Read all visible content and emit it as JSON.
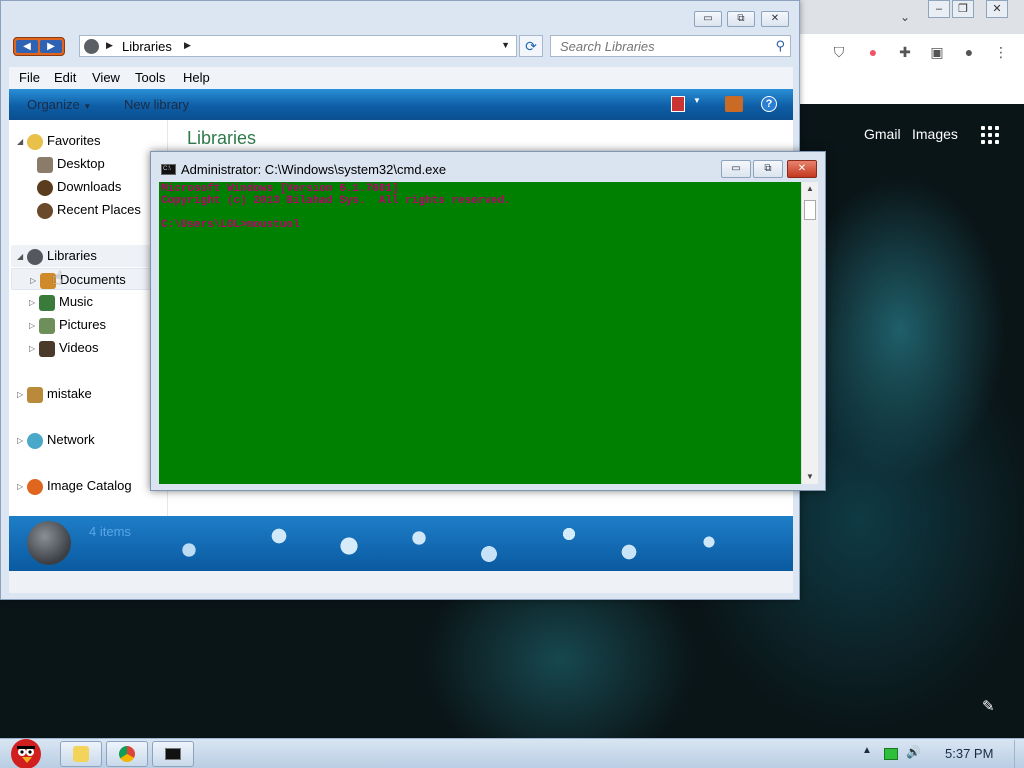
{
  "explorer": {
    "breadcrumb": "Libraries",
    "search_placeholder": "Search Libraries",
    "menu": [
      "File",
      "Edit",
      "View",
      "Tools",
      "Help"
    ],
    "toolbar": {
      "organize": "Organize",
      "new_library": "New library"
    },
    "content_title": "Libraries",
    "nav": {
      "favorites": "Favorites",
      "desktop": "Desktop",
      "downloads": "Downloads",
      "recent": "Recent Places",
      "libraries": "Libraries",
      "documents": "Documents",
      "music": "Music",
      "pictures": "Pictures",
      "videos": "Videos",
      "mistake": "mistake",
      "network": "Network",
      "image_catalog": "Image Catalog"
    },
    "status_count": "4 items"
  },
  "cmd": {
    "title": "Administrator: C:\\Windows\\system32\\cmd.exe",
    "line1": "Microsoft Windows [Version 6.1.7601]",
    "line2": "Copyright (c) 2013 Bilahad Sys.  All rights reserved.",
    "line3": "",
    "line4": "C:\\Users\\LOL>moustuol"
  },
  "chrome": {
    "gmail": "Gmail",
    "images": "Images"
  },
  "taskbar": {
    "time": "5:37 PM"
  },
  "colors": {
    "console_bg": "#008000",
    "console_text": "#b8006b",
    "accent_green": "#2f7a4d"
  }
}
